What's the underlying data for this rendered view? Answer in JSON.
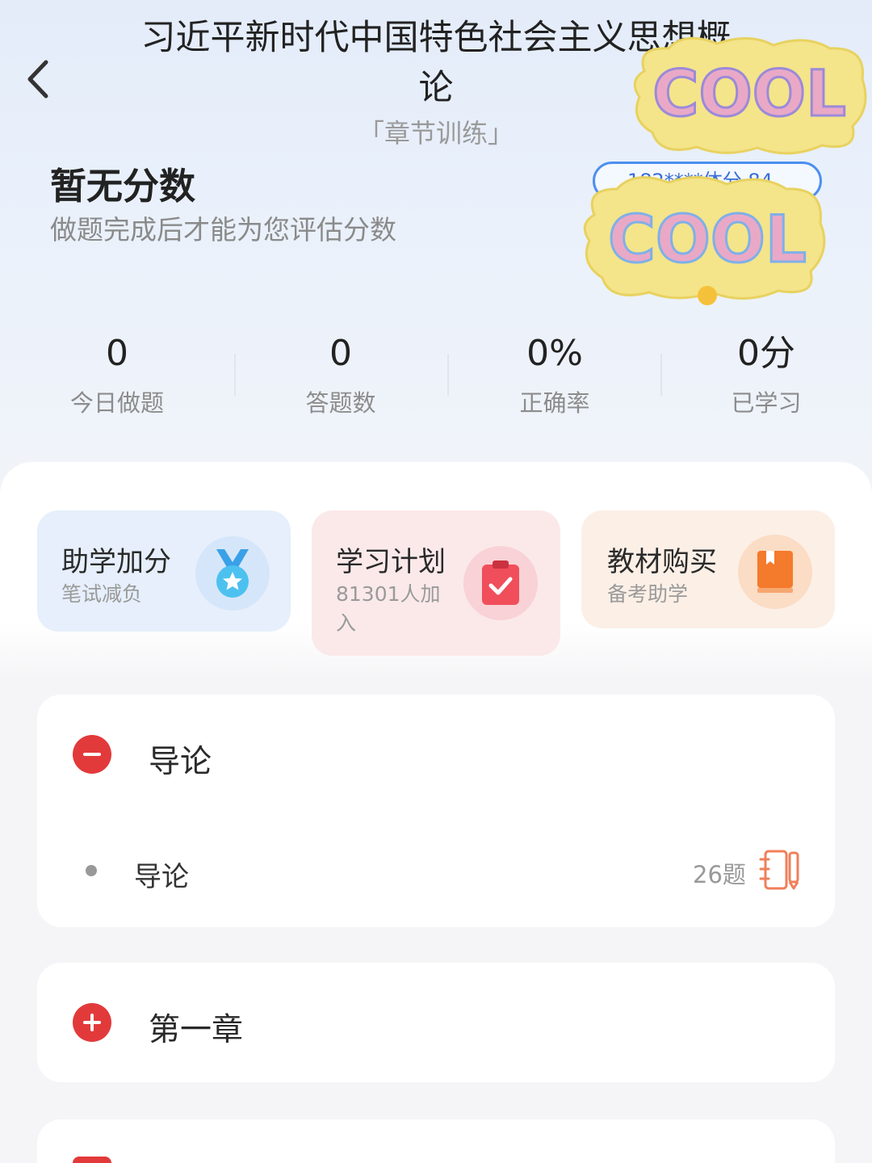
{
  "header": {
    "title": "习近平新时代中国特色社会主义思想概论",
    "subtitle": "「章节训练」",
    "user_pill": "182****体分 84"
  },
  "score": {
    "title": "暂无分数",
    "description": "做题完成后才能为您评估分数"
  },
  "stats": [
    {
      "value": "0",
      "label": "今日做题"
    },
    {
      "value": "0",
      "label": "答题数"
    },
    {
      "value": "0%",
      "label": "正确率"
    },
    {
      "value": "0分",
      "label": "已学习"
    }
  ],
  "feature_cards": [
    {
      "title": "助学加分",
      "subtitle": "笔试减负",
      "icon": "medal-icon"
    },
    {
      "title": "学习计划",
      "subtitle": "81301人加入",
      "icon": "clipboard-check-icon"
    },
    {
      "title": "教材购买",
      "subtitle": "备考助学",
      "icon": "book-icon"
    }
  ],
  "chapters": [
    {
      "title": "导论",
      "expanded": true,
      "sections": [
        {
          "title": "导论",
          "count": "26题"
        }
      ]
    },
    {
      "title": "第一章",
      "expanded": false
    }
  ],
  "stickers": {
    "text": "COOL"
  },
  "colors": {
    "accent_red": "#e23a3a",
    "blue_card": "#e6effb",
    "red_card": "#fbe9ea",
    "orange_card": "#fcefe6",
    "pill_border": "#4d8ff0"
  }
}
